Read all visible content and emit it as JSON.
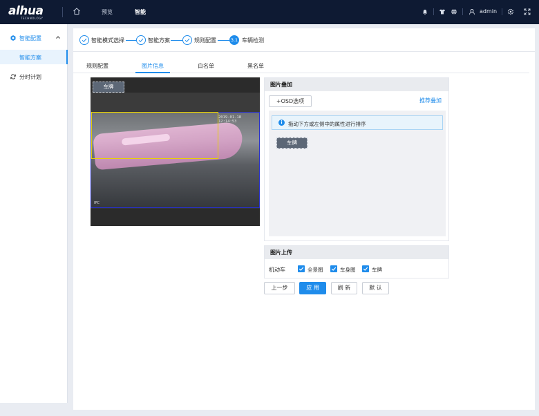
{
  "header": {
    "logo_text": "alhua",
    "logo_sub": "TECHNOLOGY",
    "nav": [
      "预览",
      "智能"
    ],
    "user": "admin"
  },
  "sidebar": {
    "group_label": "智能配置",
    "sub_label": "智能方案",
    "item_label": "分时计划"
  },
  "steps": [
    {
      "label": "智能模式选择"
    },
    {
      "label": "智能方案"
    },
    {
      "label": "规则配置"
    },
    {
      "label": "车辆检测",
      "number": "3.1"
    }
  ],
  "tabs": [
    "规则配置",
    "图片信息",
    "白名单",
    "黑名单"
  ],
  "video": {
    "tag": "车牌",
    "timestamp": "2019-01-18 12:14:53",
    "channel": "IPC"
  },
  "overlay_panel": {
    "title": "图片叠加",
    "osd_button": "+OSD选项",
    "recommend_link": "推荐叠加",
    "info_text": "拖动下方或左侧中的属性进行排序",
    "chip_label": "车牌"
  },
  "upload_panel": {
    "title": "图片上传",
    "row_label": "机动车",
    "options": [
      {
        "label": "全景图",
        "checked": true
      },
      {
        "label": "车身图",
        "checked": true
      },
      {
        "label": "车牌",
        "checked": true
      }
    ]
  },
  "buttons": {
    "prev": "上一步",
    "apply": "应 用",
    "refresh": "刷 新",
    "default": "默 认"
  },
  "colors": {
    "accent": "#1f8ceb",
    "topbar": "#0e1a33"
  }
}
